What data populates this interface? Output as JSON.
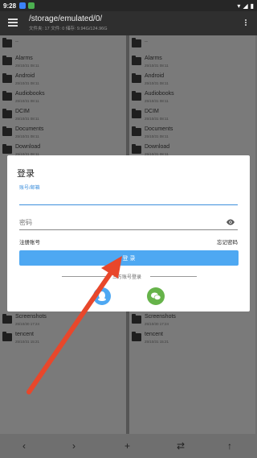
{
  "status_bar": {
    "time": "9:28"
  },
  "app_bar": {
    "path": "/storage/emulated/0/",
    "subtitle": "文件夹: 17  文件: 0  储存: 9.94G/124.96G"
  },
  "file_list": {
    "left": [
      {
        "name": "..",
        "date": ""
      },
      {
        "name": "Alarms",
        "date": "25/10/31 08:11"
      },
      {
        "name": "Android",
        "date": "25/10/31 08:11"
      },
      {
        "name": "Audiobooks",
        "date": "25/10/31 08:11"
      },
      {
        "name": "DCIM",
        "date": "25/10/31 08:11"
      },
      {
        "name": "Documents",
        "date": "25/10/31 08:11"
      },
      {
        "name": "Download",
        "date": "25/10/31 08:11"
      },
      {
        "name": "Screenshots",
        "date": "25/10/30 17:24"
      },
      {
        "name": "tencent",
        "date": "25/10/31 15:21"
      }
    ],
    "right": [
      {
        "name": "..",
        "date": ""
      },
      {
        "name": "Alarms",
        "date": "25/10/31 08:11"
      },
      {
        "name": "Android",
        "date": "25/10/31 08:11"
      },
      {
        "name": "Audiobooks",
        "date": "25/10/31 08:11"
      },
      {
        "name": "DCIM",
        "date": "25/10/31 08:11"
      },
      {
        "name": "Documents",
        "date": "25/10/31 08:11"
      },
      {
        "name": "Download",
        "date": "25/10/31 08:11"
      },
      {
        "name": "Screenshots",
        "date": "25/10/30 17:24"
      },
      {
        "name": "tencent",
        "date": "25/10/31 15:21"
      }
    ]
  },
  "login_dialog": {
    "title": "登录",
    "account_label": "账号/邮箱",
    "password_placeholder": "密码",
    "register_label": "注册账号",
    "forgot_label": "忘记密码",
    "login_button": "登 录",
    "third_party_label": "三方账号登录"
  },
  "bottom_bar": {
    "add_label": "+"
  },
  "colors": {
    "accent": "#4ea8f2",
    "qq": "#4ea8f2",
    "wechat": "#66b34a",
    "arrow": "#e8472b"
  }
}
